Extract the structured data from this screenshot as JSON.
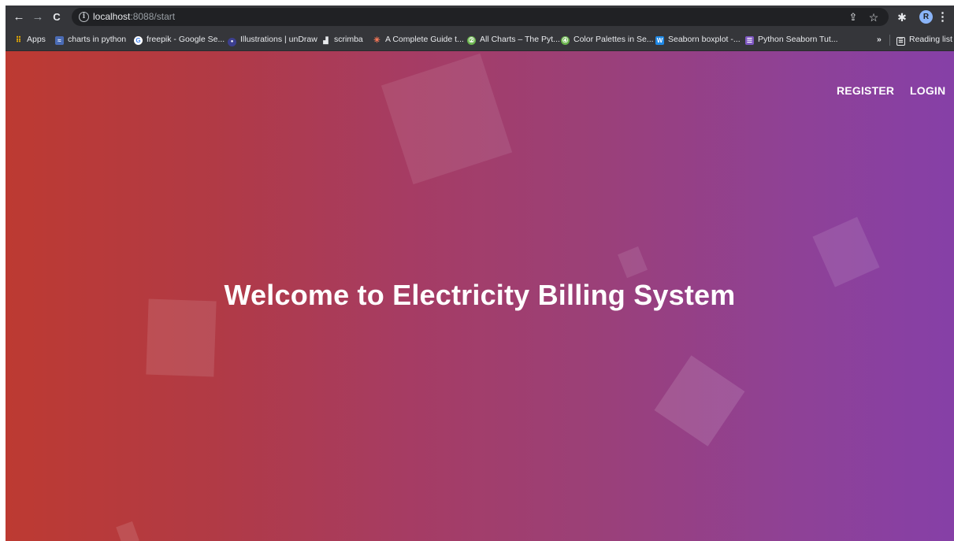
{
  "browser": {
    "nav": {
      "back_glyph": "←",
      "forward_glyph": "→",
      "reload_glyph": "C"
    },
    "omnibox": {
      "host": "localhost",
      "path": ":8088/start",
      "info_glyph": "i"
    },
    "toolbar_icons": {
      "share_glyph": "⇪",
      "star_glyph": "☆",
      "puzzle_glyph": "✱",
      "menu_glyph": "⋮",
      "profile_initial": "R"
    },
    "bookmarks": [
      {
        "label": "Apps",
        "icon": "apps-grid-icon",
        "fav": "⠿",
        "color": "#f4b400"
      },
      {
        "label": "charts in python",
        "icon": "geeks-icon",
        "fav": "≈",
        "color": "#4a6bb5"
      },
      {
        "label": "freepik - Google Se...",
        "icon": "google-icon",
        "fav": "G",
        "color": "#ffffff"
      },
      {
        "label": "Illustrations | unDraw",
        "icon": "undraw-icon",
        "fav": "●",
        "color": "#6c63ff"
      },
      {
        "label": "scrimba",
        "icon": "scrimba-icon",
        "fav": "▟",
        "color": "#ffffff"
      },
      {
        "label": "A Complete Guide t...",
        "icon": "css-tricks-icon",
        "fav": "✳",
        "color": "#ff7a59"
      },
      {
        "label": "All Charts – The Pyt...",
        "icon": "python-graph-icon",
        "fav": "②",
        "color": "#69b34c"
      },
      {
        "label": "Color Palettes in Se...",
        "icon": "python-graph-icon",
        "fav": "④",
        "color": "#69b34c"
      },
      {
        "label": "Seaborn boxplot -...",
        "icon": "w3-icon",
        "fav": "W",
        "color": "#1e88e5"
      },
      {
        "label": "Python Seaborn Tut...",
        "icon": "list-icon",
        "fav": "☰",
        "color": "#7e57c2"
      }
    ],
    "overflow_glyph": "»",
    "reading_list": "Reading list"
  },
  "page": {
    "nav": {
      "register": "REGISTER",
      "login": "LOGIN"
    },
    "heading": "Welcome to Electricity Billing System"
  },
  "colors": {
    "gradient_start": "#bd3a32",
    "gradient_end": "#8640a7",
    "text": "#ffffff"
  }
}
